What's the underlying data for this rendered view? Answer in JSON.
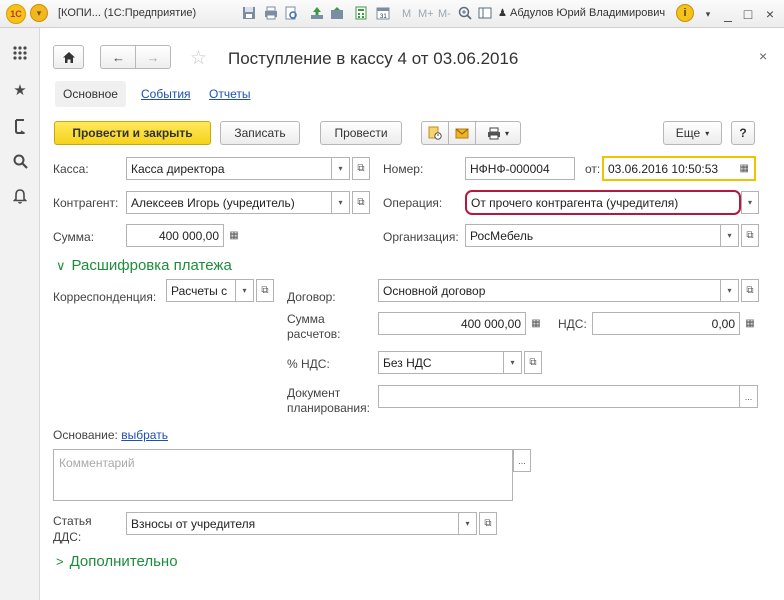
{
  "app_window": {
    "title": "[КОПИ... (1С:Предприятие)",
    "toolbar_text_buttons": [
      "M",
      "M+",
      "M-"
    ],
    "user_name": "Абдулов Юрий Владимирович",
    "info_label": "i",
    "minimize": "_",
    "maximize": "□",
    "close": "×"
  },
  "sidebar": {
    "icons": [
      "grid-menu-icon",
      "star-icon",
      "history-icon",
      "search-icon",
      "bell-icon"
    ]
  },
  "document": {
    "title": "Поступление в кассу 4 от 03.06.2016",
    "close": "×",
    "tabs": {
      "main": "Основное",
      "events": "События",
      "reports": "Отчеты"
    }
  },
  "toolbar": {
    "post_close": "Провести и закрыть",
    "save": "Записать",
    "post": "Провести",
    "more": "Еще",
    "help": "?"
  },
  "fields": {
    "kassa_label": "Касса:",
    "kassa_value": "Касса директора",
    "number_label": "Номер:",
    "number_value": "НФНФ-000004",
    "date_from_label": "от:",
    "date_value": "03.06.2016 10:50:53",
    "counterparty_label": "Контрагент:",
    "counterparty_value": "Алексеев Игорь (учредитель)",
    "operation_label": "Операция:",
    "operation_value": "От прочего контрагента (учредителя)",
    "sum_label": "Сумма:",
    "sum_value": "400 000,00",
    "organization_label": "Организация:",
    "organization_value": "РосМебель"
  },
  "payment_section": {
    "title": "Расшифровка платежа",
    "correspondence_label": "Корреспонденция:",
    "correspondence_value": "Расчеты с",
    "contract_label": "Договор:",
    "contract_value": "Основной договор",
    "settlement_sum_label_1": "Сумма",
    "settlement_sum_label_2": "расчетов:",
    "settlement_sum_value": "400 000,00",
    "vat_label": "НДС:",
    "vat_value": "0,00",
    "vat_rate_label": "% НДС:",
    "vat_rate_value": "Без НДС",
    "planning_doc_label_1": "Документ",
    "planning_doc_label_2": "планирования:",
    "planning_doc_value": ""
  },
  "basis": {
    "label": "Основание:",
    "link": "выбрать"
  },
  "comment": {
    "placeholder": "Комментарий"
  },
  "dds": {
    "label_1": "Статья",
    "label_2": "ДДС:",
    "value": "Взносы от учредителя"
  },
  "additional_section": {
    "title": "Дополнительно"
  },
  "colors": {
    "primary_button": "#f5d31c",
    "section_title": "#1d8d3b",
    "link": "#1c4fb3",
    "operation_highlight": "#b5173e",
    "date_highlight": "#f0c300"
  }
}
